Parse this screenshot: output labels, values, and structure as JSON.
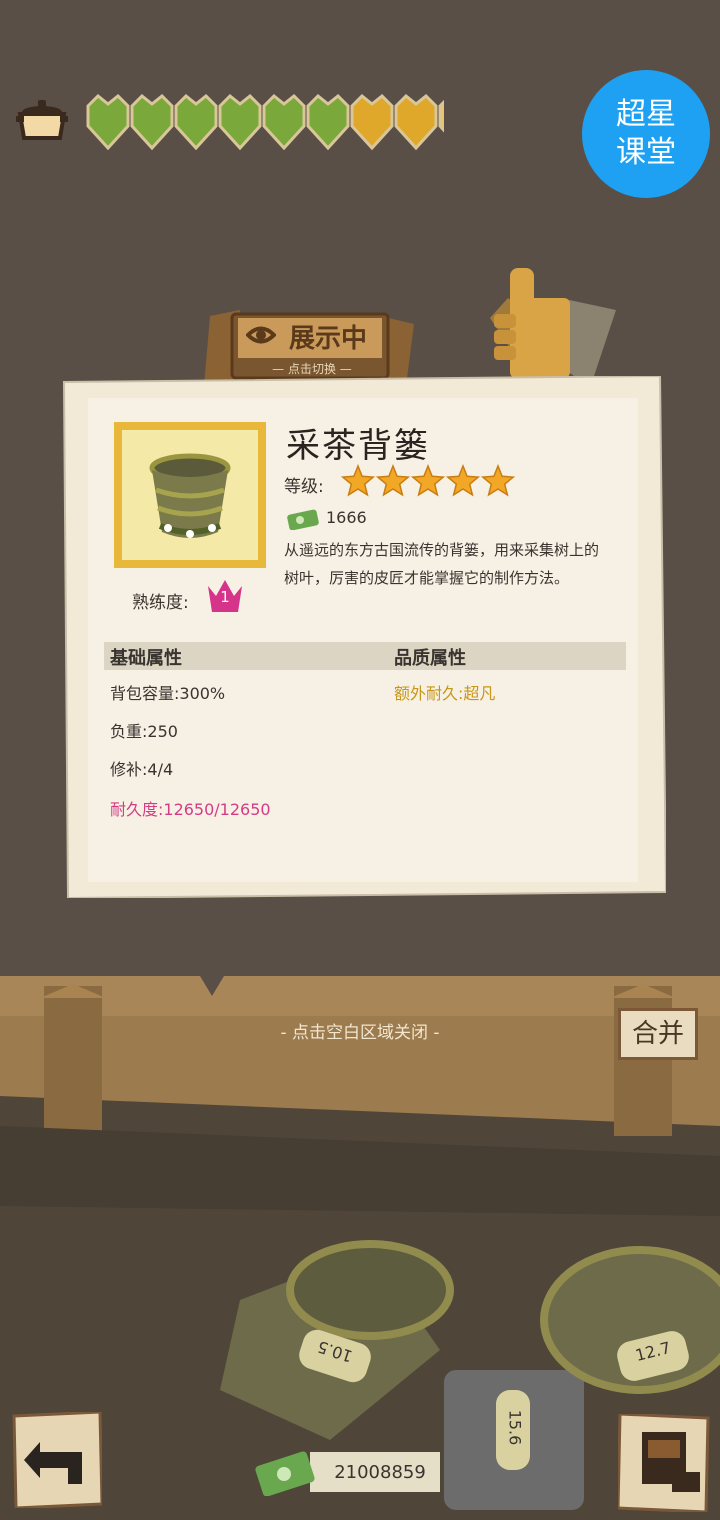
{
  "brand": {
    "line1": "超星",
    "line2": "课堂"
  },
  "showcase_sign": {
    "title": "展示中",
    "subtitle": "— 点击切换 —"
  },
  "hearts": {
    "green": 6,
    "gold": 2,
    "partial": 1
  },
  "item": {
    "name": "采茶背篓",
    "level_label": "等级:",
    "stars": 5,
    "price": "1666",
    "description": "从遥远的东方古国流传的背篓，用来采集树上的树叶，厉害的皮匠才能掌握它的制作方法。",
    "mastery_label": "熟练度:",
    "mastery_level": "1"
  },
  "attributes": {
    "basic_header": "基础属性",
    "quality_header": "品质属性",
    "basic": [
      "背包容量:300%",
      "负重:250",
      "修补:4/4"
    ],
    "durability": "耐久度:12650/12650",
    "quality": [
      "额外耐久:超凡"
    ]
  },
  "close_hint": "- 点击空白区域关闭 -",
  "merge_button": "合并",
  "inventory_tags": [
    "10.5",
    "15.6",
    "12.7"
  ],
  "money": "21008859",
  "colors": {
    "accent_gold": "#c89618",
    "durability_pink": "#d63b86",
    "brand_blue": "#1ea1f2"
  },
  "icons": [
    "pot-icon",
    "heart-icon",
    "thumbs-up-icon",
    "eye-icon",
    "star-icon",
    "money-icon",
    "crown-icon",
    "back-arrow-icon",
    "backpack-icon"
  ]
}
